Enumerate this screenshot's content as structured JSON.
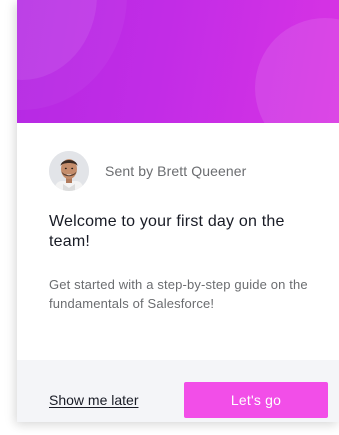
{
  "colors": {
    "hero_gradient_start": "#b529e3",
    "hero_gradient_end": "#d833e4",
    "button_background": "#f24ee8",
    "footer_background": "#f4f5f8",
    "title_text": "#181b25",
    "muted_text": "#6b6d70"
  },
  "card": {
    "sender": {
      "avatar_icon": "person-avatar",
      "label": "Sent by Brett Queener"
    },
    "title": "Welcome to your first day on the team!",
    "description": "Get started with a step-by-step guide on the fundamentals of Salesforce!",
    "footer": {
      "later_label": "Show me later",
      "go_label": "Let's go"
    }
  }
}
